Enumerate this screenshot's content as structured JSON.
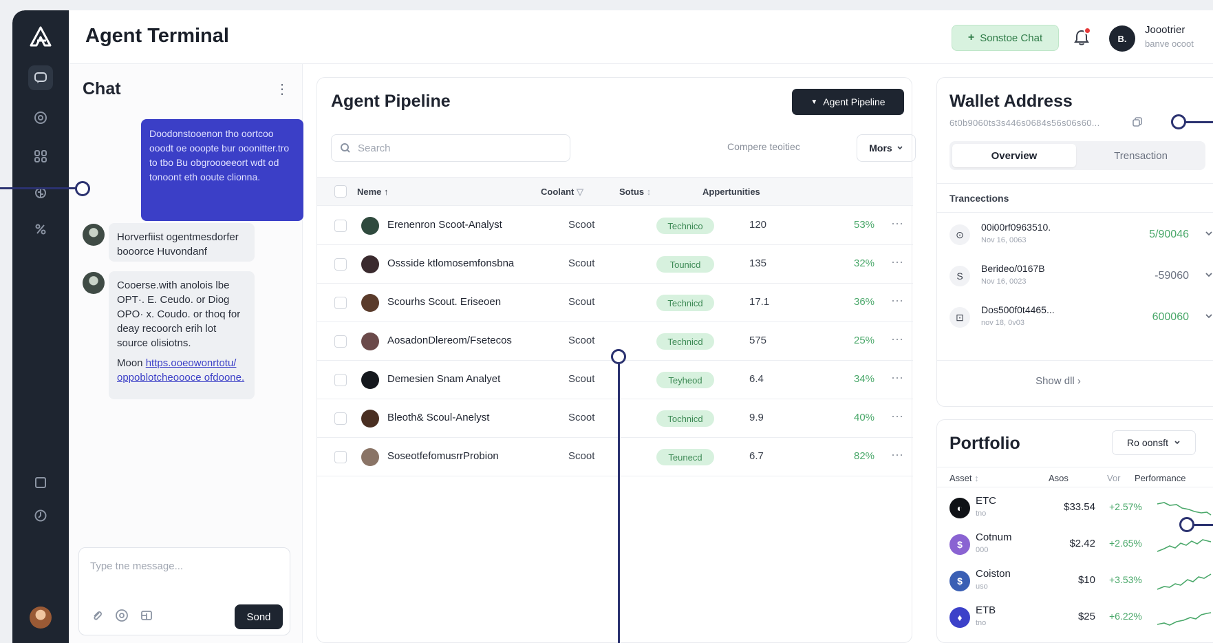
{
  "header": {
    "title": "Agent Terminal",
    "new_chat_label": "Sonstoe Chat",
    "user_initials": "B.",
    "user_name": "Joootrier",
    "user_sub": "banve ocoot"
  },
  "rail": {
    "items": [
      "chat-icon",
      "target-icon",
      "grid-icon",
      "brain-icon",
      "percent-icon"
    ],
    "bottom": [
      "layout-icon",
      "clock-icon",
      "avatar"
    ]
  },
  "chat": {
    "title": "Chat",
    "user_message": "Doodonstooenon tho oortcoo ooodt oe ooopte bur ooonitter.tro to tbo Bu obgroooeeort wdt od tonoont eth ooute clionna.",
    "bot_message_1": "Horverfiist ogentmesdorfer booorce Huvondanf",
    "bot_message_2": "Cooerse.with anolois lbe OPT·. E. Ceudo. or Diog OPO· x. Coudo. or thoq for deay recoorch erih lot source olisiotns.",
    "bot_more_prefix": "Moon",
    "bot_more_link": "https.ooeowonrtotu/ oppoblotcheoooce ofdoone.",
    "composer_placeholder": "Type tne message...",
    "send_label": "Sond"
  },
  "pipeline": {
    "title": "Agent Pipeline",
    "button_label": "Agent Pipeline",
    "search_placeholder": "Search",
    "compare_label": "Compere teoitiec",
    "more_label": "Mors",
    "columns": [
      "Neme",
      "Coolant",
      "Sotus",
      "Appertunities"
    ],
    "rows": [
      {
        "name": "Erenenron Scoot-Analyst",
        "content": "Scoot",
        "status": "Technico",
        "opps": "120",
        "pct": "53%",
        "avatar": "#2f4a3e"
      },
      {
        "name": "Ossside ktlomosemfonsbna",
        "content": "Scout",
        "status": "Tounicd",
        "opps": "135",
        "pct": "32%",
        "avatar": "#3a2a2e"
      },
      {
        "name": "Scourhs Scout. Eriseoen",
        "content": "Scout",
        "status": "Technicd",
        "opps": "17.1",
        "pct": "36%",
        "avatar": "#5a3b2b"
      },
      {
        "name": "AosadonDlereom/Fsetecos",
        "content": "Scoot",
        "status": "Technicd",
        "opps": "575",
        "pct": "25%",
        "avatar": "#6b4a4a"
      },
      {
        "name": "Demesien Snam Analyet",
        "content": "Scout",
        "status": "Teyheod",
        "opps": "6.4",
        "pct": "34%",
        "avatar": "#15181d"
      },
      {
        "name": "Bleoth& Scoul-Anelyst",
        "content": "Scoot",
        "status": "Tochnicd",
        "opps": "9.9",
        "pct": "40%",
        "avatar": "#4a2f22"
      },
      {
        "name": "SoseotfefomusrrProbion",
        "content": "Scoot",
        "status": "Teunecd",
        "opps": "6.7",
        "pct": "82%",
        "avatar": "#8a7466"
      }
    ]
  },
  "wallet": {
    "title": "Wallet Address",
    "address": "6t0b9060ts3s446s0684s56s06s60...",
    "tab_active": "Overview",
    "tab_inactive": "Trensaction",
    "section": "Trancections",
    "transactions": [
      {
        "icon": "⊙",
        "title": "00i00rf0963510.",
        "date": "Nov 16, 0063",
        "amount": "5/90046",
        "color": "#4aa86a"
      },
      {
        "icon": "S",
        "title": "Berideo/0167B",
        "date": "Nov 16, 0023",
        "amount": "-59060",
        "color": "#6b7280"
      },
      {
        "icon": "⊡",
        "title": "Dos500f0t4465...",
        "date": "nov 18, 0v03",
        "amount": "600060",
        "color": "#4aa86a"
      }
    ],
    "show_all": "Show dll"
  },
  "portfolio": {
    "title": "Portfolio",
    "select_label": "Ro oonsft",
    "columns": [
      "Asset",
      "Asos",
      "Vor",
      "Performance"
    ],
    "assets": [
      {
        "symbol": "ETC",
        "sub": "tno",
        "price": "$33.54",
        "change": "+2.57%",
        "color": "#0f1216",
        "glyph": "◐"
      },
      {
        "symbol": "Cotnum",
        "sub": "000",
        "price": "$2.42",
        "change": "+2.65%",
        "color": "#8a63d2",
        "glyph": "$"
      },
      {
        "symbol": "Coiston",
        "sub": "uso",
        "price": "$10",
        "change": "+3.53%",
        "color": "#3a5fb4",
        "glyph": "$"
      },
      {
        "symbol": "ETB",
        "sub": "tno",
        "price": "$25",
        "change": "+6.22%",
        "color": "#3c41c9",
        "glyph": "♦"
      }
    ]
  }
}
